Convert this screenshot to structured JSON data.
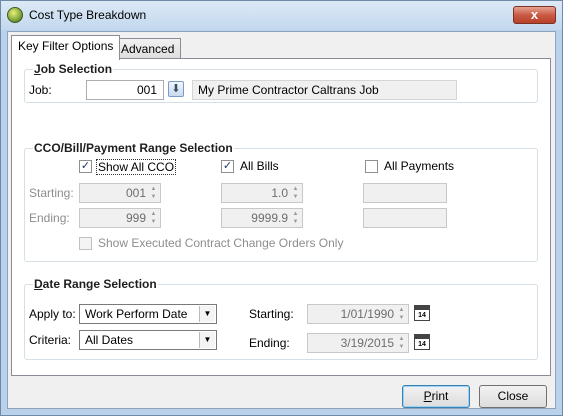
{
  "window": {
    "title": "Cost Type Breakdown",
    "close_glyph": "x"
  },
  "tabs": [
    {
      "label": "Key Filter Options",
      "active": true
    },
    {
      "label": "Advanced",
      "active": false
    }
  ],
  "job_selection": {
    "title": "Job Selection",
    "job_label": "Job:",
    "job_value": "001",
    "job_description": "My Prime Contractor Caltrans Job",
    "lookup_icon": "arrow-down-icon"
  },
  "range_selection": {
    "title": "CCO/Bill/Payment Range Selection",
    "show_all_cco": {
      "label": "Show All CCO",
      "checked": true
    },
    "all_bills": {
      "label": "All Bills",
      "checked": true
    },
    "all_payments": {
      "label": "All Payments",
      "checked": false
    },
    "starting_label": "Starting:",
    "ending_label": "Ending:",
    "cco_start": "001",
    "cco_end": "999",
    "bill_start": "1.0",
    "bill_end": "9999.9",
    "payment_start": "",
    "payment_end": "",
    "show_executed": {
      "label": "Show Executed Contract Change Orders Only",
      "checked": false
    }
  },
  "date_range": {
    "title": "Date Range Selection",
    "apply_to_label": "Apply to:",
    "apply_to_value": "Work Perform Date",
    "criteria_label": "Criteria:",
    "criteria_value": "All Dates",
    "starting_label": "Starting:",
    "starting_value": "1/01/1990",
    "ending_label": "Ending:",
    "ending_value": "3/19/2015",
    "calendar_day": "14"
  },
  "buttons": {
    "print": "Print",
    "close": "Close"
  }
}
